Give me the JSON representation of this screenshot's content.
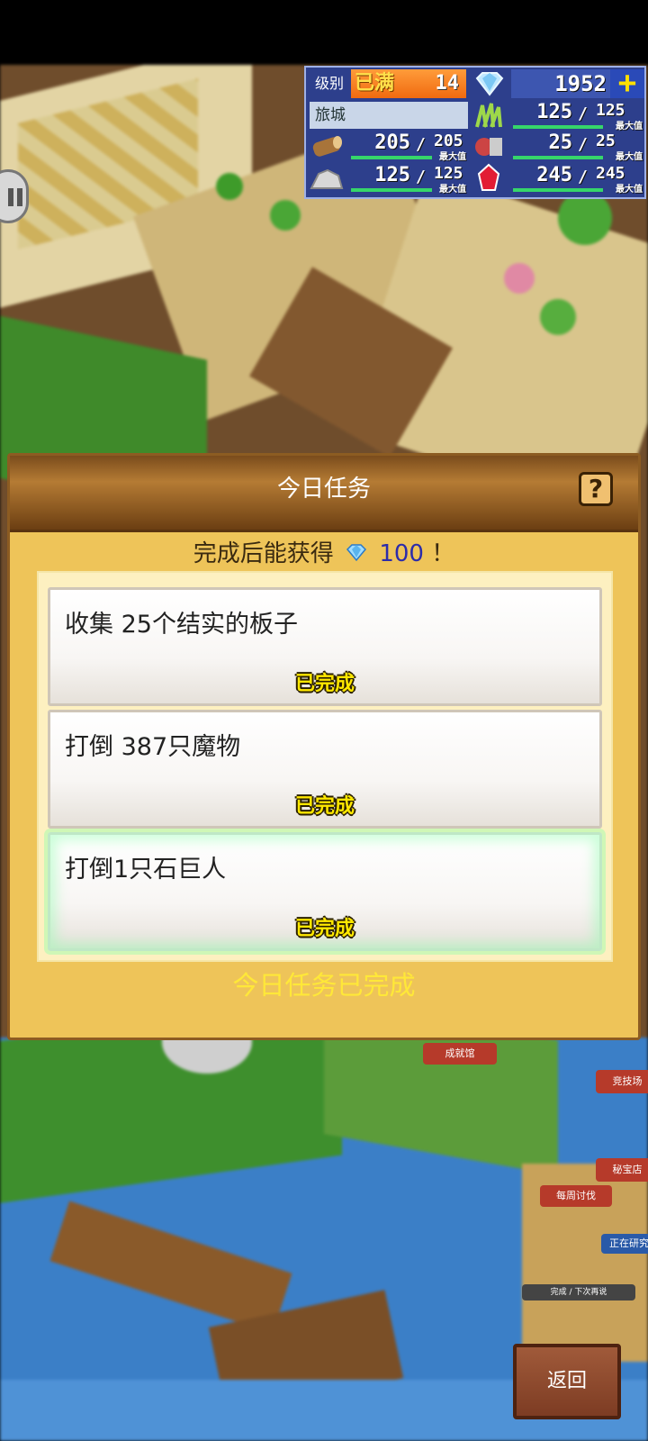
{
  "hud": {
    "level_label": "级别",
    "level_max_text": "已满",
    "level_value": "14",
    "gems": "1952",
    "plus": "+",
    "town_name": "旅城",
    "max_label": "最大值",
    "resources": [
      {
        "name": "grass",
        "icon": "grass-icon",
        "current": "125",
        "max": "125"
      },
      {
        "name": "wood",
        "icon": "wood-icon",
        "current": "205",
        "max": "205"
      },
      {
        "name": "food",
        "icon": "food-icon",
        "current": "25",
        "max": "25"
      },
      {
        "name": "ore",
        "icon": "ore-icon",
        "current": "125",
        "max": "125"
      },
      {
        "name": "crystal",
        "icon": "crystal-icon",
        "current": "245",
        "max": "245"
      }
    ]
  },
  "dialog": {
    "title": "今日任务",
    "help": "?",
    "reward_prefix": "完成后能获得",
    "reward_amount": "100",
    "reward_suffix": "！",
    "tasks": [
      {
        "description": "收集 25个结实的板子",
        "status": "已完成"
      },
      {
        "description": "打倒 387只魔物",
        "status": "已完成"
      },
      {
        "description": "打倒1只石巨人",
        "status": "已完成"
      }
    ],
    "all_done": "今日任务已完成"
  },
  "background_labels": {
    "achievement_hall": "成就馆",
    "arena": "竞技场",
    "treasure_shop": "秘宝店",
    "weekly_hunt": "每周讨伐",
    "researching": "正在研究",
    "finish_later": "完成 / 下次再说"
  },
  "return_button": "返回",
  "colors": {
    "dialog_bg": "#eec459",
    "header": "#8e5b22",
    "done_text": "#ffe800",
    "reward_amount": "#2c2caa",
    "hud_bg": "#2d3f8c"
  }
}
